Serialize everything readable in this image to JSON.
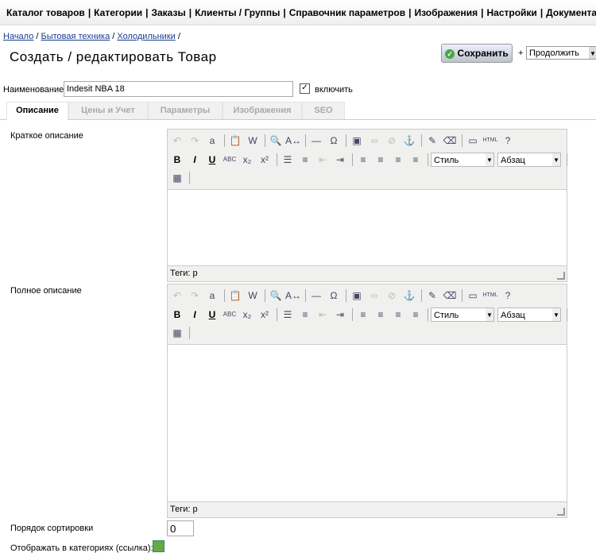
{
  "nav": [
    "Каталог товаров",
    "Категории",
    "Заказы",
    "Клиенты / Группы",
    "Справочник параметров",
    "Изображения",
    "Настройки",
    "Документация"
  ],
  "breadcrumb": [
    "Начало",
    "Бытовая техника",
    "Холодильники"
  ],
  "title": "Создать / редактировать Товар",
  "save_label": "Сохранить",
  "plus": "+",
  "after_save": "Продолжить",
  "name_label": "Наименование",
  "name_value": "Indesit NBA 18",
  "enable_label": "включить",
  "tabs": [
    "Описание",
    "Цены и Учет",
    "Параметры",
    "Изображения",
    "SEO"
  ],
  "short_desc_label": "Краткое описание",
  "full_desc_label": "Полное описание",
  "editor": {
    "style": "Стиль",
    "format": "Абзац",
    "status": "Теги: p"
  },
  "sort_label": "Порядок сортировки",
  "sort_value": "0",
  "show_in_categories_label": "Отображать в категориях (ссылка):"
}
